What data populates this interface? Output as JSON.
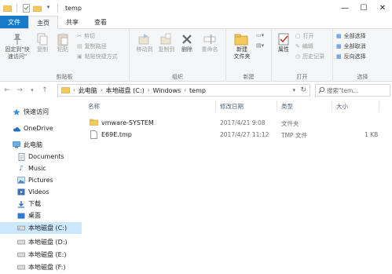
{
  "window": {
    "title": "temp",
    "minimize": "—",
    "maximize": "☐",
    "close": "✕"
  },
  "tabs": [
    {
      "label": "文件"
    },
    {
      "label": "主页"
    },
    {
      "label": "共享"
    },
    {
      "label": "查看"
    }
  ],
  "ribbon": {
    "clipboard": {
      "label": "剪贴板",
      "pin": "固定到\"快\n速访问\"",
      "copy": "复制",
      "paste": "粘贴",
      "cut": "剪切",
      "copy_path": "复制路径",
      "paste_shortcut": "粘贴快捷方式"
    },
    "organize": {
      "label": "组织",
      "move_to": "移动到",
      "copy_to": "复制到",
      "delete": "删除",
      "rename": "重命名"
    },
    "new": {
      "label": "新建",
      "new_folder": "新建\n文件夹"
    },
    "open": {
      "label": "打开",
      "properties": "属性",
      "open": "打开",
      "edit": "编辑",
      "history": "历史记录"
    },
    "select": {
      "label": "选择",
      "select_all": "全部选择",
      "select_none": "全部取消",
      "invert": "反向选择"
    }
  },
  "address": {
    "crumbs": [
      "此电脑",
      "本地磁盘 (C:)",
      "Windows",
      "temp"
    ],
    "search_placeholder": "搜索\"tem..."
  },
  "nav": [
    {
      "label": "快速访问",
      "icon": "star-icon"
    },
    {
      "label": "OneDrive",
      "icon": "cloud-icon"
    },
    {
      "label": "此电脑",
      "icon": "computer-icon"
    },
    {
      "label": "Documents",
      "icon": "document-icon"
    },
    {
      "label": "Music",
      "icon": "music-icon"
    },
    {
      "label": "Pictures",
      "icon": "picture-icon"
    },
    {
      "label": "Videos",
      "icon": "video-icon"
    },
    {
      "label": "下载",
      "icon": "download-icon"
    },
    {
      "label": "桌面",
      "icon": "desktop-icon"
    },
    {
      "label": "本地磁盘 (C:)",
      "icon": "drive-icon"
    },
    {
      "label": "本地磁盘 (D:)",
      "icon": "drive-icon"
    },
    {
      "label": "本地磁盘 (E:)",
      "icon": "drive-icon"
    },
    {
      "label": "本地磁盘 (F:)",
      "icon": "drive-icon"
    }
  ],
  "columns": {
    "name": "名称",
    "date": "修改日期",
    "type": "类型",
    "size": "大小"
  },
  "files": [
    {
      "name": "vmware-SYSTEM",
      "date": "2017/4/21 9:08",
      "type": "文件夹",
      "size": "",
      "icon": "folder-icon"
    },
    {
      "name": "E69E.tmp",
      "date": "2017/4/27 11:12",
      "type": "TMP 文件",
      "size": "1 KB",
      "icon": "file-icon"
    }
  ],
  "colors": {
    "file_tab": "#1979ca",
    "selection": "#cce8ff",
    "folder": "#f6c95b"
  }
}
